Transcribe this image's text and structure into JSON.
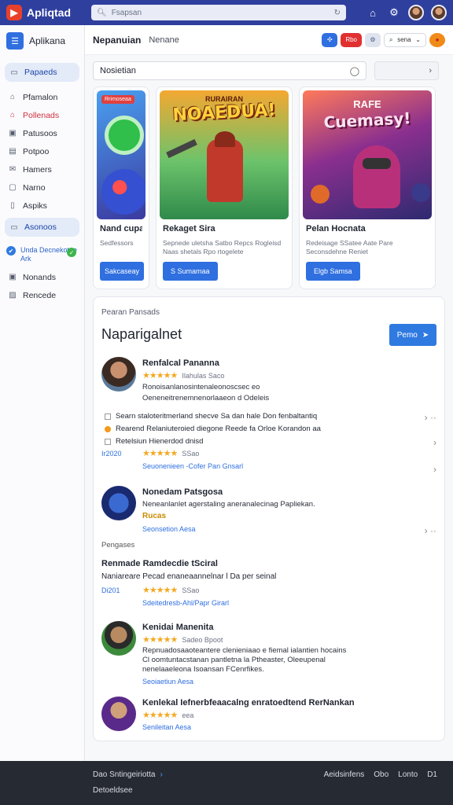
{
  "topbar": {
    "brand": "Apliqtad",
    "search_placeholder": "Fsapsan"
  },
  "sidebar": {
    "title": "Aplikana",
    "items": [
      {
        "label": "Papaeds",
        "icon": "folder-icon",
        "active": true
      },
      {
        "label": "Pfamalon",
        "icon": "lock-icon"
      },
      {
        "label": "Pollenads",
        "icon": "tag-icon",
        "red": true
      },
      {
        "label": "Patusoos",
        "icon": "box-icon"
      },
      {
        "label": "Potpoo",
        "icon": "doc-icon"
      },
      {
        "label": "Hamers",
        "icon": "mail-icon"
      },
      {
        "label": "Narno",
        "icon": "card-icon"
      },
      {
        "label": "Aspiks",
        "icon": "page-icon"
      },
      {
        "label": "Asonoos",
        "icon": "archive-icon",
        "active": true
      }
    ],
    "promo": "Unda Decnekotne Ark",
    "extra": [
      {
        "label": "Nonands",
        "icon": "gift-icon"
      },
      {
        "label": "Rencede",
        "icon": "chart-icon"
      }
    ]
  },
  "header": {
    "title": "Nepanuian",
    "subtitle": "Nenane",
    "red_pill": "Rbo",
    "search_label": "sena"
  },
  "main_search": {
    "placeholder": "Nosietian"
  },
  "cards": [
    {
      "badge": "Rrimoseaa",
      "title": "Nand cupana",
      "desc": "Sedfessors",
      "button": "Sakcaseay"
    },
    {
      "art_title": "NOAEDUA!",
      "art_kicker": "RURAIRAN",
      "title": "Rekaget Sira",
      "desc": "Sepnede uletsha Satbo Repcs Rogleisd Naas shetals Rpo rtogelete",
      "button": "S Sumamaa"
    },
    {
      "art_title": "Cuemasy!",
      "art_kicker": "RAFE",
      "title": "Pelan Hocnata",
      "desc": "Redeisage SSatee Aate Pare Seconsdehne Reniet",
      "button": "Elgb Samsa"
    }
  ],
  "reviews_panel": {
    "kicker": "Pearan Pansads",
    "heading": "Naparigalnet",
    "button": "Pemo",
    "reviews": [
      {
        "name": "Renfalcal Pananna",
        "rating": 4.5,
        "meta": "Ilahulas Saco",
        "text": "Ronoisanlanosintenaleonoscsec eo",
        "text2": "Oeneneitrenemnenorlaaeon d Odeleis",
        "bullets": [
          "Searn staloteritmerland shecve Sa dan hale Don fenbaltantiq",
          "Rearend Relaniuteroied diegone Reede fa Orloe Korandon aa",
          "Retelsiun Hienerdod dnisd"
        ],
        "date": "Ir2020",
        "rating2": 4.5,
        "meta2": "SSao",
        "link": "Seuonenieen -Cofer Pan Gnsarl"
      },
      {
        "name": "Nonedam Patsgosa",
        "text": "Neneanlanlet agerstaling aneranalecinag Papliekan.",
        "badge": "Rucas",
        "link": "Seonsetion Aesa"
      }
    ],
    "section_label": "Pengases",
    "thread_title": "Renmade Ramdecdie tSciral",
    "thread_text": "Naniareare Pecad enaneaannelnar l Da per seinal",
    "date2": "Di201",
    "meta3": "SSao",
    "link3": "Sdeitedresb-Ahl/Papr Girarl",
    "review3": {
      "name": "Kenidai Manenita",
      "meta": "Sadeo Bpoot",
      "text": "Repnuadosaaoteantere clenieniaao e fiemal ialantien hocains Cl oomtuntacstanan pantletna la Ptheaster, Oleeupenal nenelaaeleona Isoansan FCenrfikes.",
      "link": "Seoiaetiun Aesa"
    },
    "review4": {
      "name": "Kenlekal Iefnerbfeaacalng enratoedtend RerNankan",
      "meta": "eea",
      "link": "Senileitan Aesa"
    }
  },
  "footer": {
    "line1": "Dao Sntingeiriotta",
    "line2": "Detoeldsee",
    "links": [
      "Aeidsinfens",
      "Obo",
      "Lonto",
      "D1"
    ]
  },
  "colors": {
    "primary": "#2f3f9e",
    "accent": "#2f6fe0",
    "star": "#f2a922"
  }
}
